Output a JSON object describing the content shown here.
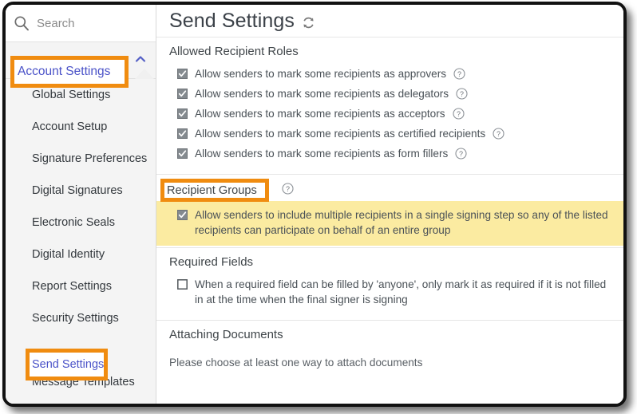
{
  "sidebar": {
    "search": {
      "placeholder": "Search",
      "value": "",
      "icon": "search-icon"
    },
    "account_settings": {
      "label": "Account Settings",
      "chevron": "chevron-up-icon",
      "highlighted": true
    },
    "items": [
      {
        "label": "Global Settings",
        "active": false
      },
      {
        "label": "Account Setup",
        "active": false
      },
      {
        "label": "Signature Preferences",
        "active": false
      },
      {
        "label": "Digital Signatures",
        "active": false
      },
      {
        "label": "Electronic Seals",
        "active": false
      },
      {
        "label": "Digital Identity",
        "active": false
      },
      {
        "label": "Report Settings",
        "active": false
      },
      {
        "label": "Security Settings",
        "active": false
      },
      {
        "label": "Send Settings",
        "active": true
      },
      {
        "label": "Message Templates",
        "active": false
      }
    ]
  },
  "main": {
    "title": "Send Settings",
    "title_icon": "refresh-icon",
    "sections": [
      {
        "heading": "Allowed Recipient Roles",
        "options": [
          {
            "label": "Allow senders to mark some recipients as approvers",
            "checked": true,
            "help": true
          },
          {
            "label": "Allow senders to mark some recipients as delegators",
            "checked": true,
            "help": true
          },
          {
            "label": "Allow senders to mark some recipients as acceptors",
            "checked": true,
            "help": true
          },
          {
            "label": "Allow senders to mark some recipients as certified recipients",
            "checked": true,
            "help": true
          },
          {
            "label": "Allow senders to mark some recipients as form fillers",
            "checked": true,
            "help": true
          }
        ]
      },
      {
        "heading": "Recipient Groups",
        "heading_help": true,
        "heading_highlighted": true,
        "options": [
          {
            "label": "Allow senders to include multiple recipients in a single signing step so any of the listed recipients can participate on behalf of an entire group",
            "checked": true,
            "help": false,
            "highlighted": true
          }
        ]
      },
      {
        "heading": "Required Fields",
        "options": [
          {
            "label": "When a required field can be filled by 'anyone', only mark it as required if it is not filled in at the time when the final signer is signing",
            "checked": false,
            "help": false
          }
        ]
      },
      {
        "heading": "Attaching Documents",
        "note": "Please choose at least one way to attach documents"
      }
    ]
  },
  "colors": {
    "highlight_border": "#f08c10",
    "highlight_fill": "#fbeba1",
    "link": "#4a52c8",
    "text": "#4a5157",
    "sidebar_bg": "#f4f4f4"
  }
}
